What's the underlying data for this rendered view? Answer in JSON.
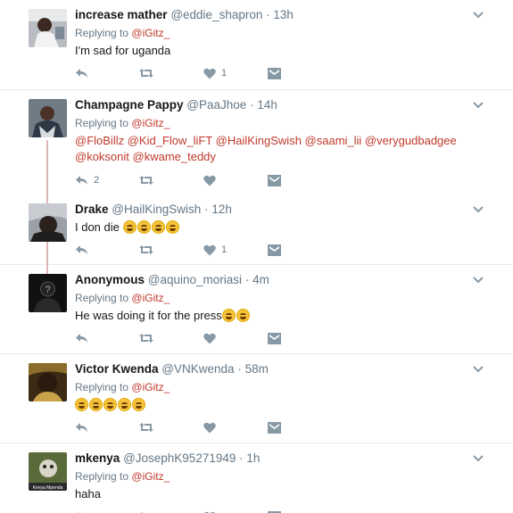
{
  "tweets": [
    {
      "name": "increase mather",
      "handle": "@eddie_shapron",
      "time": "13h",
      "reply_label": "Replying to",
      "reply_to": "@iGitz_",
      "text": "I'm sad for uganda",
      "likes": "1",
      "replies": ""
    },
    {
      "name": "Champagne Pappy",
      "handle": "@PaaJhoe",
      "time": "14h",
      "reply_label": "Replying to",
      "reply_to": "@iGitz_",
      "mentions_line1": "@FloBillz @Kid_Flow_liFT @HailKingSwish @saami_lii @verygudbadgee",
      "mentions_line2": "@koksonit @kwame_teddy",
      "likes": "",
      "replies": "2"
    },
    {
      "name": "Drake",
      "handle": "@HailKingSwish",
      "time": "12h",
      "text": "I don die",
      "emoji_count": 4,
      "likes": "1",
      "replies": ""
    },
    {
      "name": "Anonymous",
      "handle": "@aquino_moriasi",
      "time": "4m",
      "reply_label": "Replying to",
      "reply_to": "@iGitz_",
      "text": "He was doing it for the press",
      "emoji_count": 2,
      "likes": "",
      "replies": ""
    },
    {
      "name": "Victor Kwenda",
      "handle": "@VNKwenda",
      "time": "58m",
      "reply_label": "Replying to",
      "reply_to": "@iGitz_",
      "text": "",
      "emoji_count": 5,
      "likes": "",
      "replies": ""
    },
    {
      "name": "mkenya",
      "handle": "@JosephK95271949",
      "time": "1h",
      "reply_label": "Replying to",
      "reply_to": "@iGitz_",
      "text": "haha",
      "likes": "",
      "replies": ""
    }
  ],
  "avatar_caption_mkenya": "Kenya Mpenda",
  "icons": [
    "reply-icon",
    "retweet-icon",
    "like-icon",
    "dm-icon",
    "chevron-down-icon"
  ],
  "colors": {
    "mention": "#c0392b",
    "muted": "#657786",
    "icon": "#8899a6",
    "thread": "#e0b5b7"
  }
}
